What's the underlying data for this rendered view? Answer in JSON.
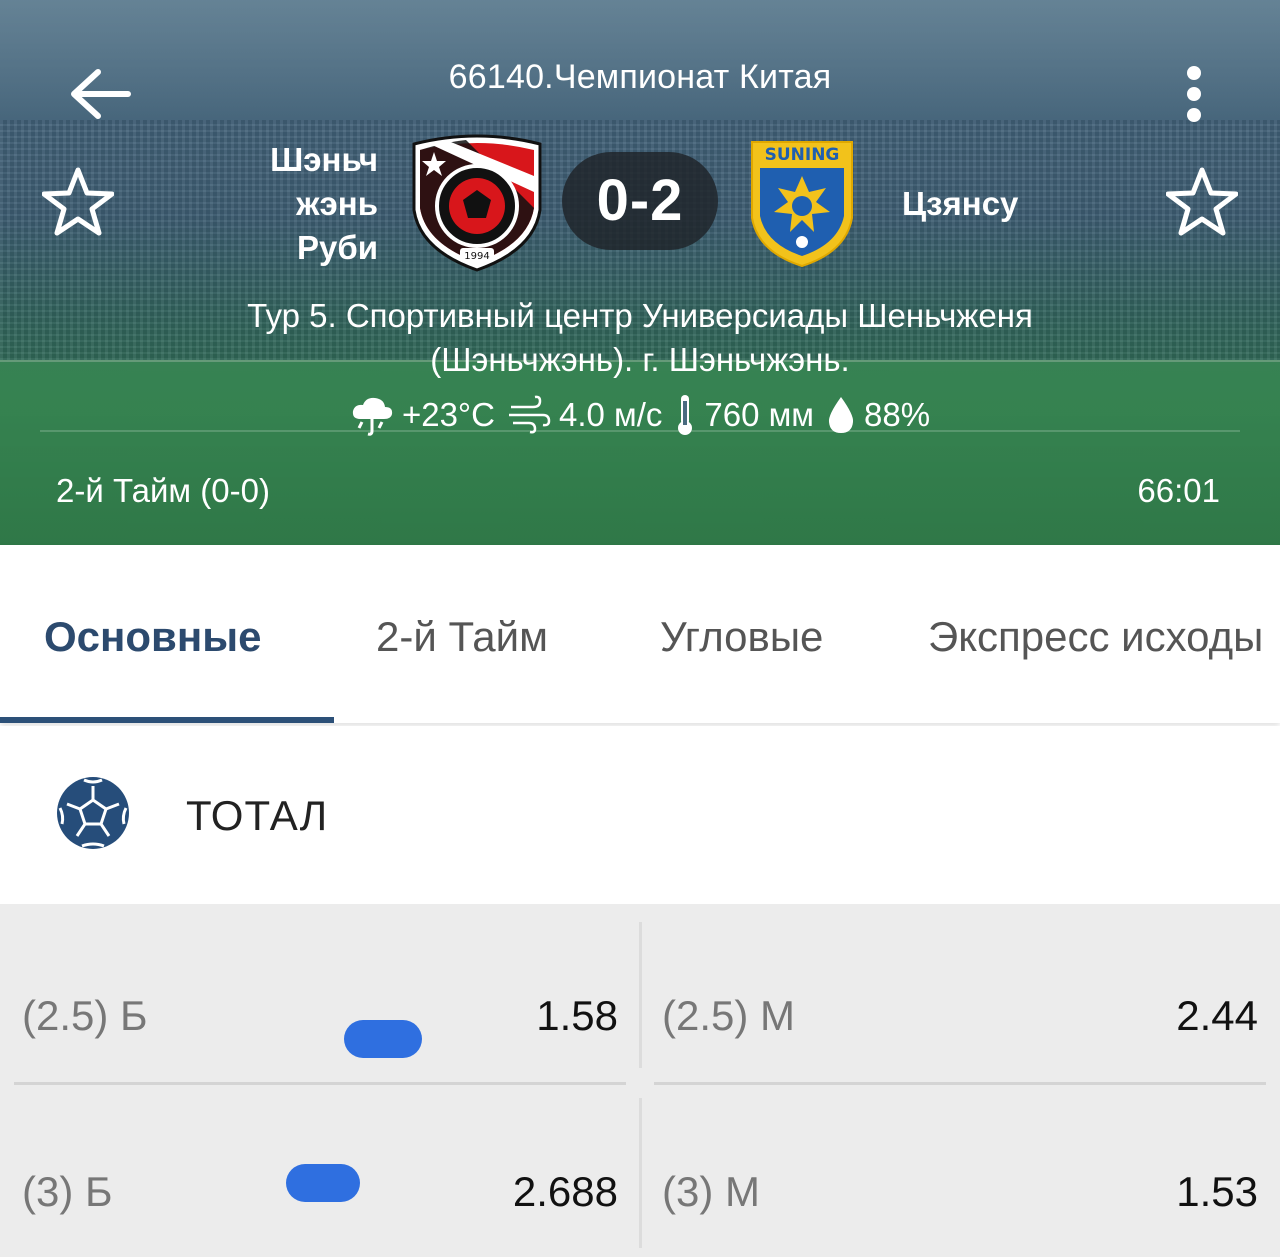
{
  "header": {
    "league_title": "66140.Чемпионат Китая",
    "home_team_lines": [
      "Шэньч",
      "жэнь",
      "Руби"
    ],
    "away_team": "Цзянсу",
    "score": "0-2",
    "venue_line1": "Тур 5. Спортивный центр Универсиады Шеньчженя",
    "venue_line2": "(Шэньчжэнь). г. Шэньчжэнь.",
    "weather": {
      "temperature": "+23°C",
      "wind": "4.0 м/с",
      "pressure": "760 мм",
      "humidity": "88%"
    },
    "period": "2-й  Тайм (0-0)",
    "clock": "66:01",
    "away_logo_text": "SUNING"
  },
  "tabs": [
    {
      "label": "Основные",
      "active": true
    },
    {
      "label": "2-й  Тайм",
      "active": false
    },
    {
      "label": "Угловые",
      "active": false
    },
    {
      "label": "Экспресс исходы",
      "active": false
    }
  ],
  "market": {
    "title": "ТОТАЛ",
    "rows": [
      {
        "left": {
          "label": "(2.5) Б",
          "odds": "1.58"
        },
        "right": {
          "label": "(2.5) М",
          "odds": "2.44"
        }
      },
      {
        "left": {
          "label": "(3) Б",
          "odds": "2.688"
        },
        "right": {
          "label": "(3) М",
          "odds": "1.53"
        }
      }
    ]
  },
  "colors": {
    "tab_active": "#2c4a6e",
    "indicator": "#2c5078",
    "ball_icon": "#264d7a",
    "odds_background": "#ececec",
    "annotation_blob": "#2f6fe0"
  }
}
